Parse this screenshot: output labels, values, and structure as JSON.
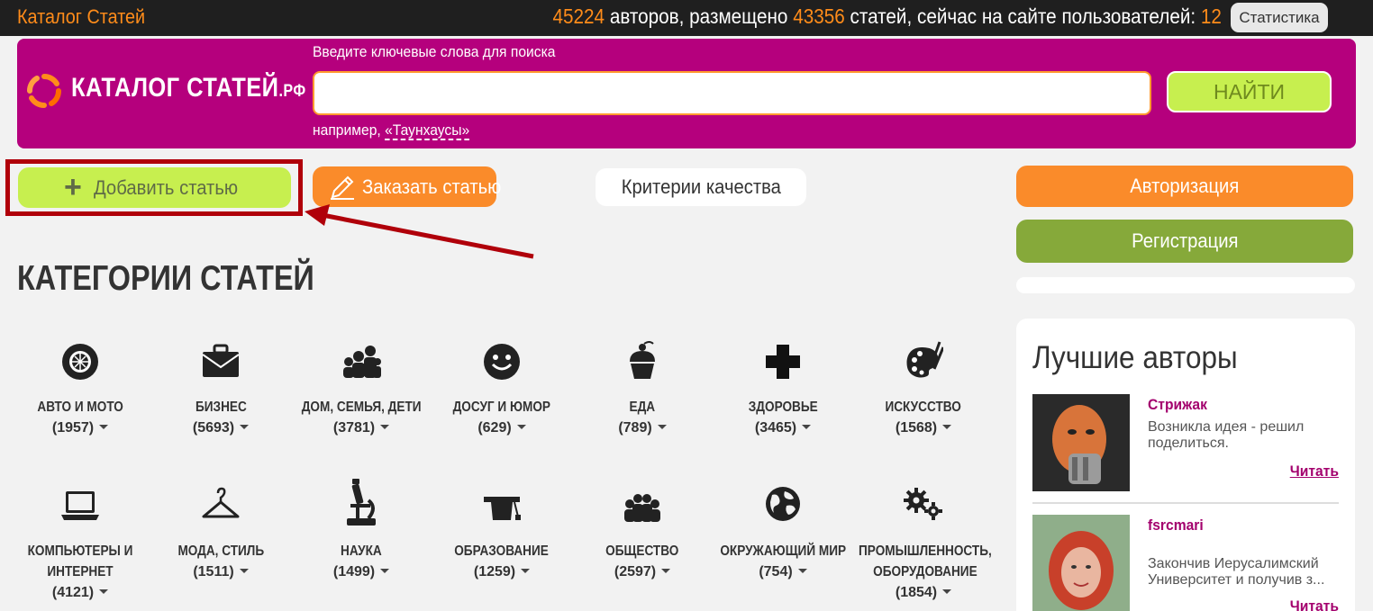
{
  "topbar": {
    "site_name": "Каталог Статей",
    "authors_count": "45224",
    "authors_text": " авторов, размещено ",
    "articles_count": "43356",
    "articles_text": " статей, сейчас на сайте пользователей: ",
    "online_count": "12",
    "stats_button": "Статистика"
  },
  "header": {
    "logo_text": "КАТАЛОГ СТАТЕЙ",
    "logo_suffix": ".РФ",
    "search_label": "Введите ключевые слова для поиска",
    "search_value": "",
    "search_button": "НАЙТИ",
    "example_prefix": "например, ",
    "example_link": "«Таунхаусы»"
  },
  "actions": {
    "add_article": "Добавить статью",
    "order_article": "Заказать статью",
    "quality_criteria": "Критерии качества"
  },
  "sidebar": {
    "login": "Авторизация",
    "register": "Регистрация",
    "best_authors_title": "Лучшие авторы",
    "authors": [
      {
        "name": "Стрижак",
        "desc": "Возникла идея - решил поделиться.",
        "read": "Читать"
      },
      {
        "name": "fsrcmari",
        "desc": "Закончив Иерусалимский Университет и получив з...",
        "read": "Читать"
      }
    ]
  },
  "categories_title": "КАТЕГОРИИ СТАТЕЙ",
  "categories": [
    {
      "name": "АВТО И МОТО",
      "count": "(1957)",
      "icon": "wheel-icon"
    },
    {
      "name": "БИЗНЕС",
      "count": "(5693)",
      "icon": "briefcase-icon"
    },
    {
      "name": "ДОМ, СЕМЬЯ, ДЕТИ",
      "count": "(3781)",
      "icon": "family-icon"
    },
    {
      "name": "ДОСУГ И ЮМОР",
      "count": "(629)",
      "icon": "smiley-icon"
    },
    {
      "name": "ЕДА",
      "count": "(789)",
      "icon": "cupcake-icon"
    },
    {
      "name": "ЗДОРОВЬЕ",
      "count": "(3465)",
      "icon": "cross-icon"
    },
    {
      "name": "ИСКУССТВО",
      "count": "(1568)",
      "icon": "palette-icon"
    },
    {
      "name": "КОМПЬЮТЕРЫ И ИНТЕРНЕТ",
      "count": "(4121)",
      "icon": "laptop-icon"
    },
    {
      "name": "МОДА, СТИЛЬ",
      "count": "(1511)",
      "icon": "hanger-icon"
    },
    {
      "name": "НАУКА",
      "count": "(1499)",
      "icon": "microscope-icon"
    },
    {
      "name": "ОБРАЗОВАНИЕ",
      "count": "(1259)",
      "icon": "graduation-icon"
    },
    {
      "name": "ОБЩЕСТВО",
      "count": "(2597)",
      "icon": "people-icon"
    },
    {
      "name": "ОКРУЖАЮЩИЙ МИР",
      "count": "(754)",
      "icon": "globe-icon"
    },
    {
      "name": "ПРОМЫШЛЕННОСТЬ, ОБОРУДОВАНИЕ",
      "count": "(1854)",
      "icon": "gears-icon"
    }
  ],
  "colors": {
    "magenta": "#b5007d",
    "orange": "#fa8b2a",
    "lime": "#c7ef4f",
    "olive": "#86a93a",
    "highlight_red": "#b0000a"
  }
}
